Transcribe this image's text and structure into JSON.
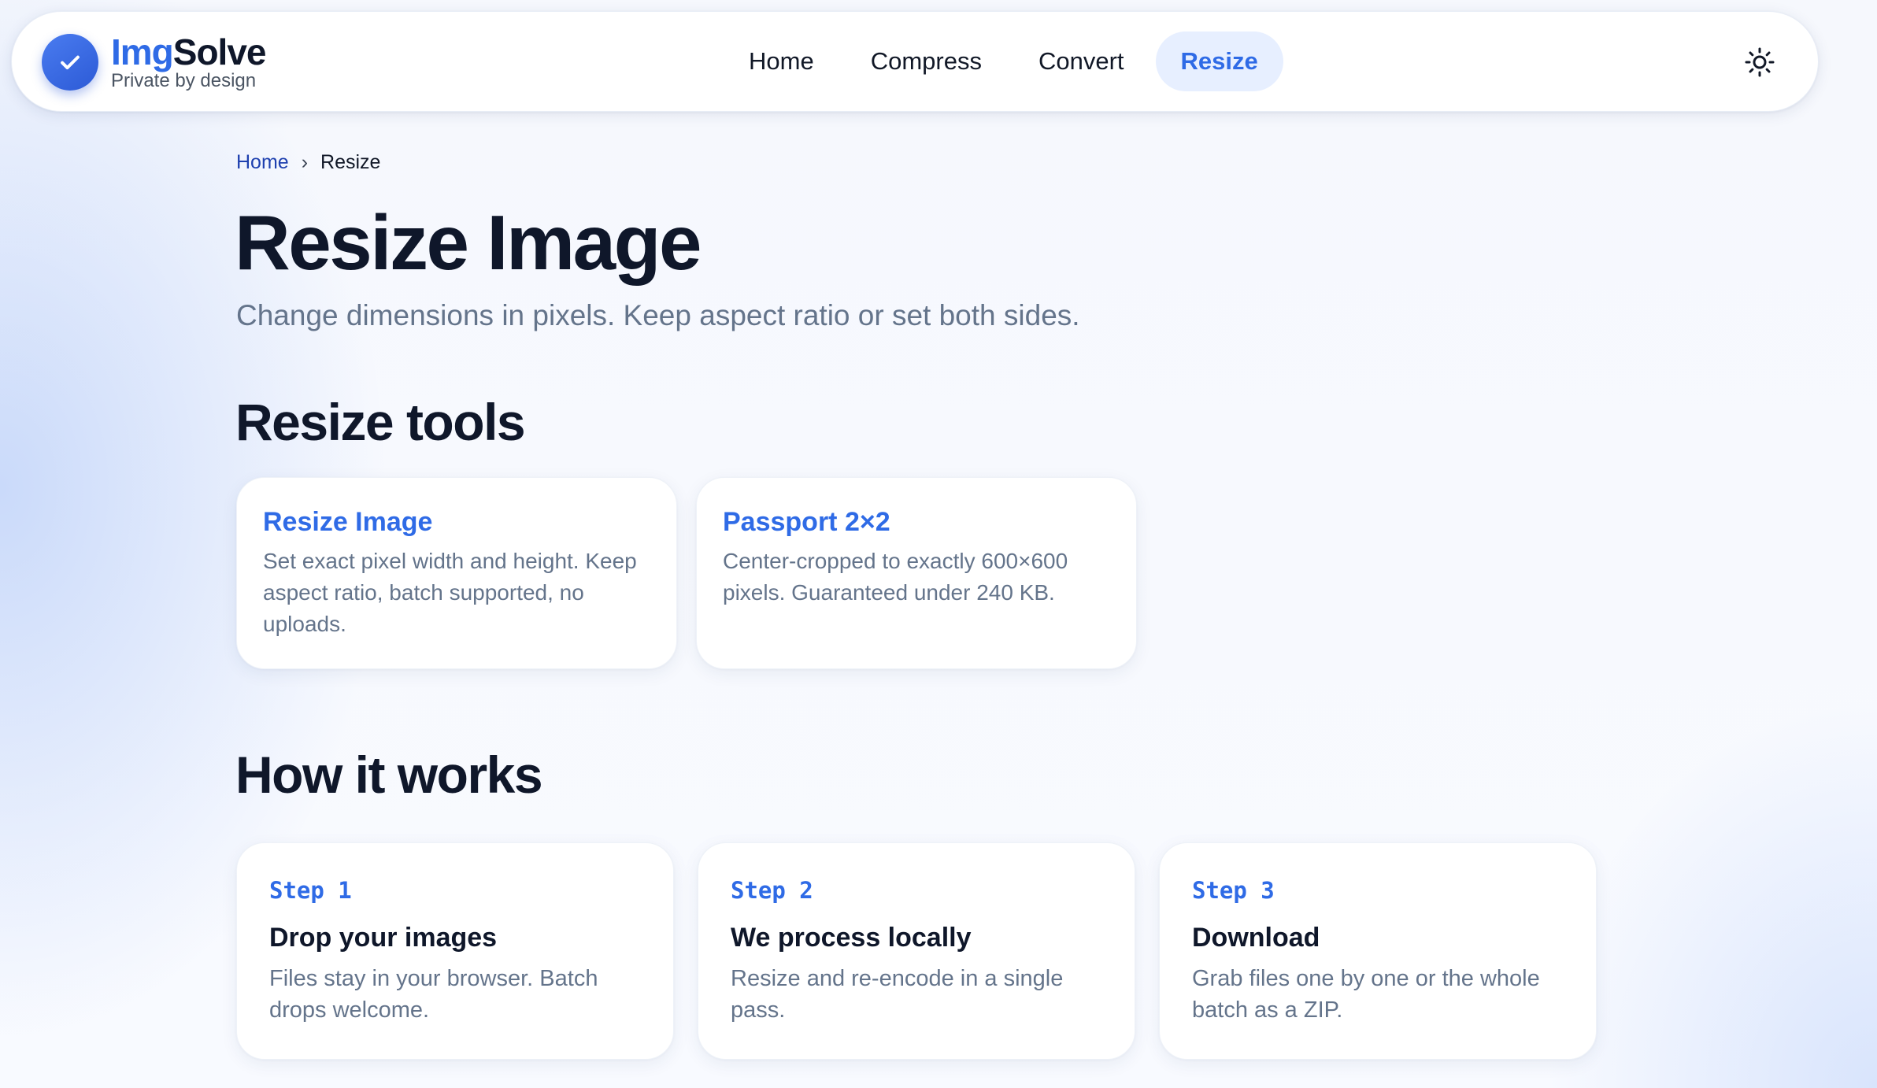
{
  "nav": {
    "brand": {
      "name_accent": "Img",
      "name_rest": "Solve",
      "tagline": "Private by design",
      "logo_icon": "check-icon"
    },
    "links": [
      {
        "label": "Home",
        "active": false
      },
      {
        "label": "Compress",
        "active": false
      },
      {
        "label": "Convert",
        "active": false
      },
      {
        "label": "Resize",
        "active": true
      }
    ],
    "theme_toggle_icon": "sun-icon"
  },
  "breadcrumb": {
    "home": "Home",
    "separator": "›",
    "current": "Resize"
  },
  "page": {
    "title": "Resize Image",
    "subtitle": "Change dimensions in pixels. Keep aspect ratio or set both sides."
  },
  "tools": {
    "heading": "Resize tools",
    "items": [
      {
        "title": "Resize Image",
        "description": "Set exact pixel width and height. Keep aspect ratio, batch supported, no uploads."
      },
      {
        "title": "Passport 2×2",
        "description": "Center-cropped to exactly 600×600 pixels. Guaranteed under 240 KB."
      }
    ]
  },
  "how": {
    "heading": "How it works",
    "steps": [
      {
        "label": "Step 1",
        "title": "Drop your images",
        "description": "Files stay in your browser. Batch drops welcome."
      },
      {
        "label": "Step 2",
        "title": "We process locally",
        "description": "Resize and re-encode in a single pass."
      },
      {
        "label": "Step 3",
        "title": "Download",
        "description": "Grab files one by one or the whole batch as a ZIP."
      }
    ]
  },
  "colors": {
    "accent": "#2f6be6",
    "text": "#0f172a",
    "muted": "#64748b",
    "active_pill": "#e7efff"
  }
}
